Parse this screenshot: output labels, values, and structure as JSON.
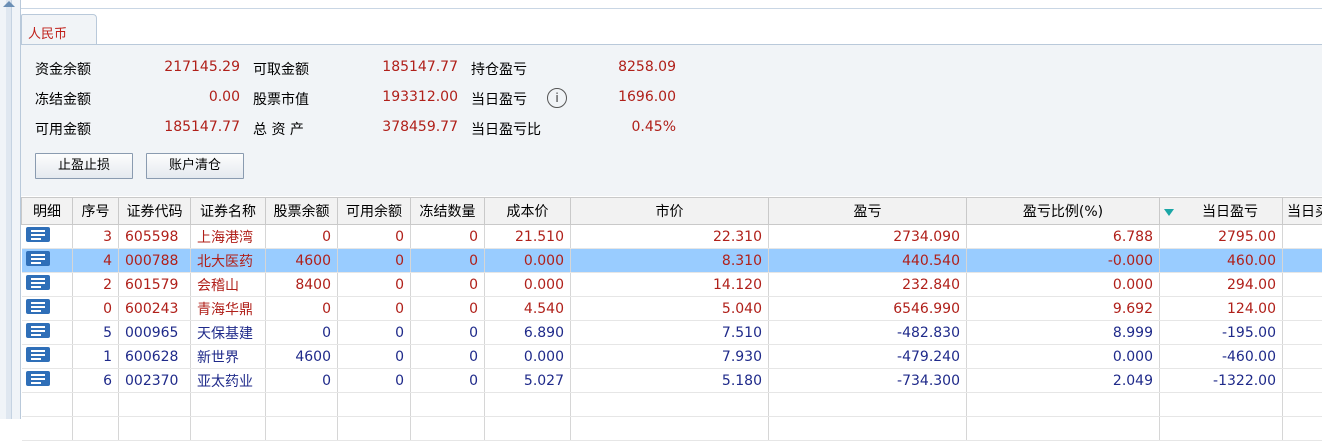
{
  "tab": {
    "label": "人民币"
  },
  "summary": [
    {
      "label": "资金余额",
      "value": "217145.29"
    },
    {
      "label": "冻结金额",
      "value": "0.00"
    },
    {
      "label": "可用金额",
      "value": "185147.77"
    },
    {
      "label": "可取金额",
      "value": "185147.77"
    },
    {
      "label": "股票市值",
      "value": "193312.00"
    },
    {
      "label": "总 资 产",
      "value": "378459.77"
    },
    {
      "label": "持仓盈亏",
      "value": "8258.09"
    },
    {
      "label": "当日盈亏",
      "value": "1696.00"
    },
    {
      "label": "当日盈亏比",
      "value": "0.45%"
    }
  ],
  "info_icon": "i",
  "buttons": {
    "stop": "止盈止损",
    "clear": "账户清仓"
  },
  "columns": [
    "明细",
    "序号",
    "证券代码",
    "证券名称",
    "股票余额",
    "可用余额",
    "冻结数量",
    "成本价",
    "市价",
    "盈亏",
    "盈亏比例(%)",
    "当日盈亏",
    "当日买"
  ],
  "rows": [
    {
      "seq": "3",
      "code": "605598",
      "name": "上海港湾",
      "bal": "0",
      "avail": "0",
      "frozen": "0",
      "cost": "21.510",
      "price": "22.310",
      "pnl": "2734.090",
      "ratio": "6.788",
      "day": "2795.00",
      "color": "r"
    },
    {
      "seq": "4",
      "code": "000788",
      "name": "北大医药",
      "bal": "4600",
      "avail": "0",
      "frozen": "0",
      "cost": "0.000",
      "price": "8.310",
      "pnl": "440.540",
      "ratio": "-0.000",
      "day": "460.00",
      "color": "r",
      "selected": true
    },
    {
      "seq": "2",
      "code": "601579",
      "name": "会稽山",
      "bal": "8400",
      "avail": "0",
      "frozen": "0",
      "cost": "0.000",
      "price": "14.120",
      "pnl": "232.840",
      "ratio": "0.000",
      "day": "294.00",
      "color": "r"
    },
    {
      "seq": "0",
      "code": "600243",
      "name": "青海华鼎",
      "bal": "0",
      "avail": "0",
      "frozen": "0",
      "cost": "4.540",
      "price": "5.040",
      "pnl": "6546.990",
      "ratio": "9.692",
      "day": "124.00",
      "color": "r"
    },
    {
      "seq": "5",
      "code": "000965",
      "name": "天保基建",
      "bal": "0",
      "avail": "0",
      "frozen": "0",
      "cost": "6.890",
      "price": "7.510",
      "pnl": "-482.830",
      "ratio": "8.999",
      "day": "-195.00",
      "color": "b"
    },
    {
      "seq": "1",
      "code": "600628",
      "name": "新世界",
      "bal": "4600",
      "avail": "0",
      "frozen": "0",
      "cost": "0.000",
      "price": "7.930",
      "pnl": "-479.240",
      "ratio": "0.000",
      "day": "-460.00",
      "color": "b"
    },
    {
      "seq": "6",
      "code": "002370",
      "name": "亚太药业",
      "bal": "0",
      "avail": "0",
      "frozen": "0",
      "cost": "5.027",
      "price": "5.180",
      "pnl": "-734.300",
      "ratio": "2.049",
      "day": "-1322.00",
      "color": "b"
    }
  ],
  "colors": {
    "positive": "#b0201a",
    "negative": "#1f2a8a",
    "selected": "#99ccff"
  }
}
